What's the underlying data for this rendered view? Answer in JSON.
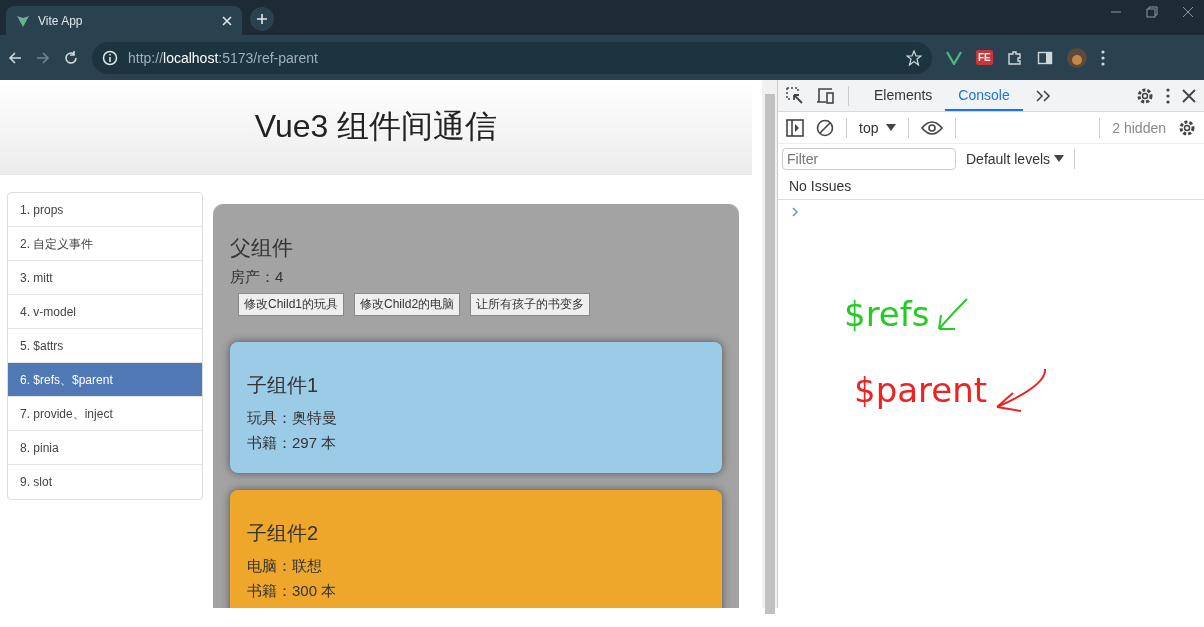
{
  "browser": {
    "tab": {
      "title": "Vite App"
    },
    "url": "http://**localhost**:5173/ref-parent",
    "extension_label": "FE"
  },
  "page": {
    "title": "Vue3 组件间通信",
    "nav": [
      {
        "label": "1. props",
        "selected": false
      },
      {
        "label": "2. 自定义事件",
        "selected": false
      },
      {
        "label": "3. mitt",
        "selected": false
      },
      {
        "label": "4. v-model",
        "selected": false
      },
      {
        "label": "5. $attrs",
        "selected": false
      },
      {
        "label": "6. $refs、$parent",
        "selected": true
      },
      {
        "label": "7. provide、inject",
        "selected": false
      },
      {
        "label": "8. pinia",
        "selected": false
      },
      {
        "label": "9. slot",
        "selected": false
      }
    ],
    "parent": {
      "title": "父组件",
      "info": "房产：4",
      "buttons": [
        "修改Child1的玩具",
        "修改Child2的电脑",
        "让所有孩子的书变多"
      ],
      "children": [
        {
          "title": "子组件1",
          "lines": [
            "玩具：奥特曼",
            "书籍：297 本"
          ],
          "color": "#9ccbe8"
        },
        {
          "title": "子组件2",
          "lines": [
            "电脑：联想",
            "书籍：300 本"
          ],
          "color": "#eea72b"
        }
      ]
    }
  },
  "devtools": {
    "tabs": [
      {
        "label": "Elements",
        "selected": false
      },
      {
        "label": "Console",
        "selected": true
      }
    ],
    "context": "top",
    "hidden": "2 hidden",
    "filter_placeholder": "Filter",
    "levels": "Default levels",
    "issues": "No Issues"
  },
  "annotations": [
    {
      "text": "$refs",
      "color": "#22cc22"
    },
    {
      "text": "$parent",
      "color": "#ee2222"
    }
  ]
}
